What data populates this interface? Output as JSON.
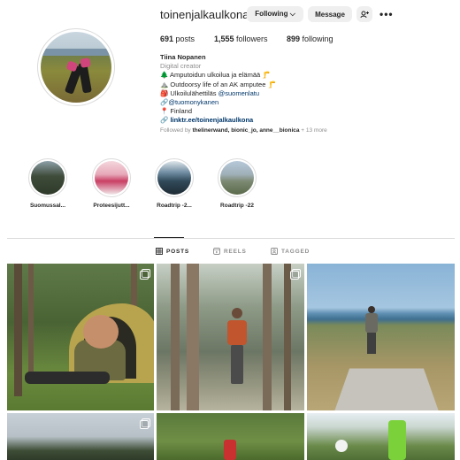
{
  "profile": {
    "username": "toinenjalkaulkona",
    "buttons": {
      "following": "Following ⌵",
      "message": "Message",
      "add_user": "+ₘ",
      "more": "•••"
    },
    "stats": {
      "posts_count": "691",
      "posts_label": "posts",
      "followers_count": "1,555",
      "followers_label": "followers",
      "following_count": "899",
      "following_label": "following"
    },
    "bio": {
      "name": "Tiina Nopanen",
      "category": "Digital creator",
      "lines": [
        "🌲 Amputoidun ulkoilua ja elämää 🦵",
        "⛰️ Outdoorsy life of an AK amputee 🦵",
        "🎒 Ulkoilulähettiläs ",
        "🔗",
        "📍 Finland"
      ],
      "mention_1": "@suomenlatu",
      "mention_2": "@tuomonykanen",
      "link": "linktr.ee/toinenjalkaulkona"
    },
    "followed_by": {
      "prefix": "Followed by ",
      "names": "thelinerwand, bionic_jo, anne__bionica",
      "suffix": " + 13 more"
    }
  },
  "highlights": [
    {
      "label": "Suomussal..."
    },
    {
      "label": "Proteesijutt..."
    },
    {
      "label": "Roadtrip -2..."
    },
    {
      "label": "Roadtrip -22"
    }
  ],
  "tabs": [
    {
      "label": "POSTS",
      "icon": "grid-icon",
      "active": true
    },
    {
      "label": "REELS",
      "icon": "reels-icon",
      "active": false
    },
    {
      "label": "TAGGED",
      "icon": "tagged-icon",
      "active": false
    }
  ],
  "colors": {
    "text": "#262626",
    "muted": "#8e8e8e",
    "link": "#00376b",
    "button_bg": "#efefef",
    "divider": "#dbdbdb"
  }
}
